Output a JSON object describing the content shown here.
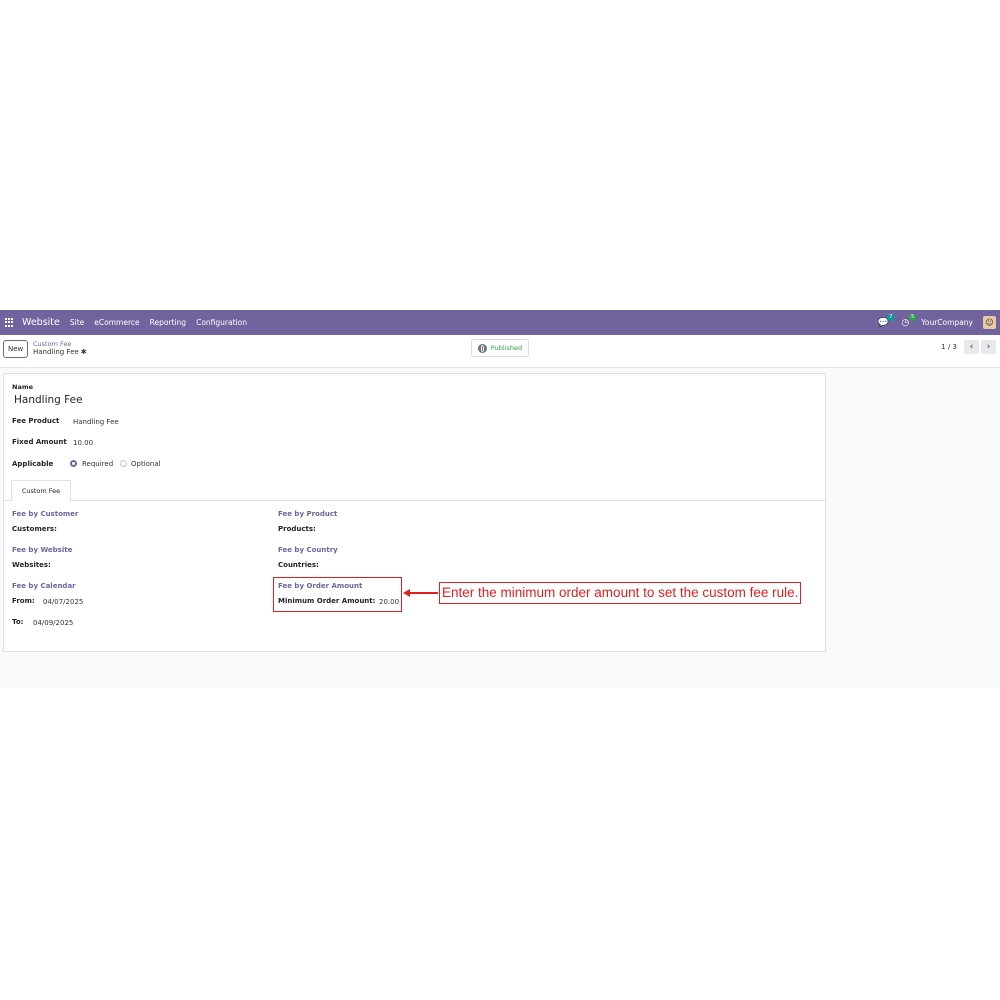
{
  "navbar": {
    "brand": "Website",
    "menu": [
      "Site",
      "eCommerce",
      "Reporting",
      "Configuration"
    ],
    "messages_badge": "7",
    "activities_badge": "5",
    "company": "YourCompany"
  },
  "control": {
    "new_label": "New",
    "breadcrumb_parent": "Custom Fee",
    "breadcrumb_current": "Handling Fee",
    "published_label": "Published",
    "pager": "1 / 3"
  },
  "form": {
    "name_label": "Name",
    "name_value": "Handling Fee",
    "fee_product_label": "Fee Product",
    "fee_product_value": "Handling Fee",
    "fixed_amount_label": "Fixed Amount",
    "fixed_amount_value": "10.00",
    "applicable_label": "Applicable",
    "applicable_options": [
      "Required",
      "Optional"
    ],
    "applicable_selected": "Required",
    "tab_label": "Custom Fee"
  },
  "sections": {
    "by_customer": {
      "title": "Fee by Customer",
      "field": "Customers:"
    },
    "by_product": {
      "title": "Fee by Product",
      "field": "Products:"
    },
    "by_website": {
      "title": "Fee by Website",
      "field": "Websites:"
    },
    "by_country": {
      "title": "Fee by Country",
      "field": "Countries:"
    },
    "by_calendar": {
      "title": "Fee by Calendar",
      "from_label": "From:",
      "from_value": "04/07/2025",
      "to_label": "To:",
      "to_value": "04/09/2025"
    },
    "by_order_amount": {
      "title": "Fee by Order Amount",
      "field": "Minimum Order Amount:",
      "value": "20.00"
    }
  },
  "annotation": {
    "text": "Enter the minimum order amount to set the custom fee rule.",
    "color": "#e02020"
  },
  "colors": {
    "brand": "#71639e",
    "published": "#28a745"
  }
}
